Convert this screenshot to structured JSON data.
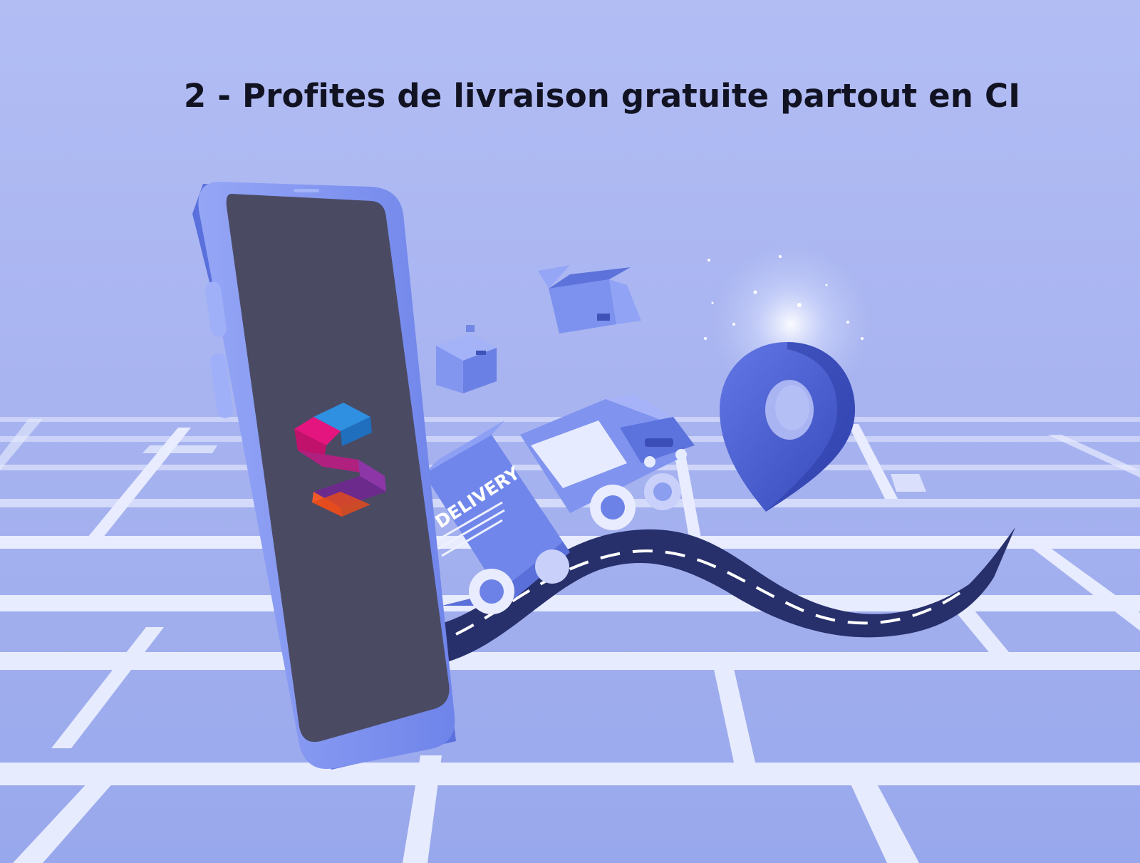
{
  "headline": "2 - Profites de livraison gratuite partout en CI",
  "truck_label": "DELIVERY",
  "icons": {
    "logo": "s-logo-icon",
    "location": "map-pin-icon",
    "box_open": "open-box-icon",
    "box_closed": "closed-box-icon",
    "truck": "delivery-truck-icon"
  },
  "colors": {
    "background": "#aab6f2",
    "phone_body": "#7e92f0",
    "phone_screen": "#4a4a63",
    "road": "#27306b",
    "pin": "#4d63d6",
    "map_lines": "#eef1ff",
    "logo_blue": "#2f8fe0",
    "logo_magenta": "#e4157e",
    "logo_purple": "#8c36a8",
    "logo_orange": "#f05a28"
  }
}
